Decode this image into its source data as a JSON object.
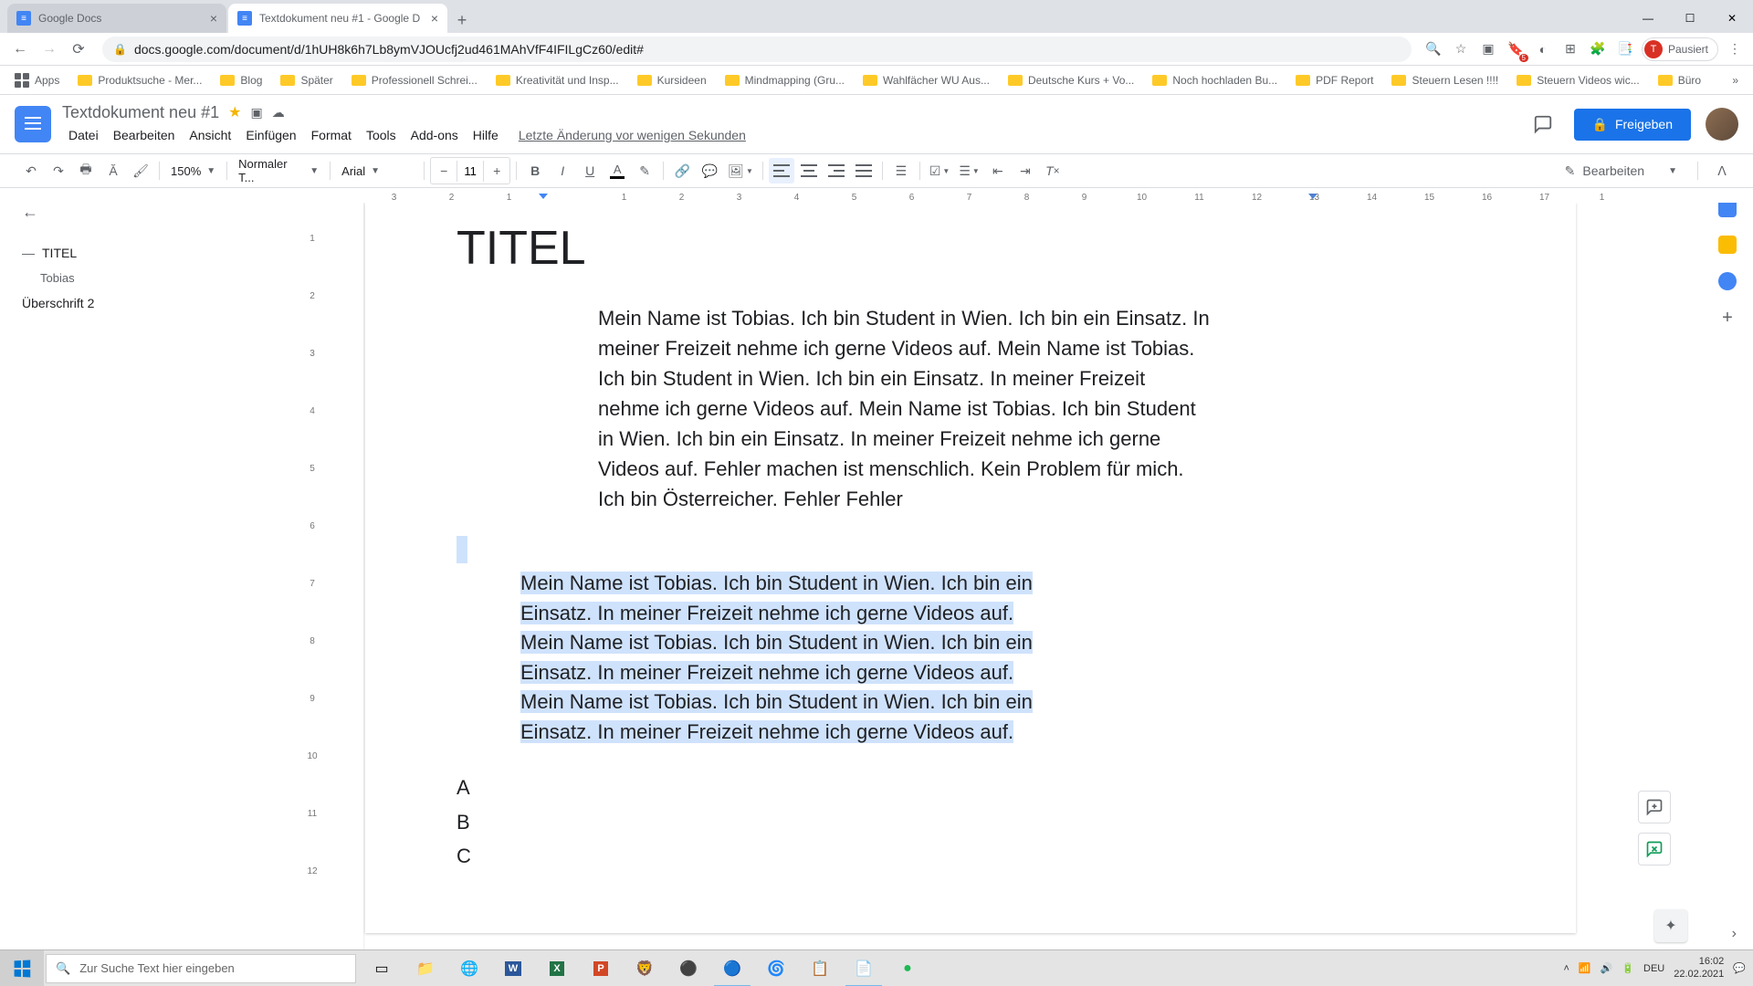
{
  "browser": {
    "tabs": [
      {
        "title": "Google Docs"
      },
      {
        "title": "Textdokument neu #1 - Google D"
      }
    ],
    "url": "docs.google.com/document/d/1hUH8k6h7Lb8ymVJOUcfj2ud461MAhVfF4IFILgCz60/edit#",
    "profile_status": "Pausiert",
    "profile_initial": "T"
  },
  "bookmarks": {
    "apps": "Apps",
    "items": [
      "Produktsuche - Mer...",
      "Blog",
      "Später",
      "Professionell Schrei...",
      "Kreativität und Insp...",
      "Kursideen",
      "Mindmapping (Gru...",
      "Wahlfächer WU Aus...",
      "Deutsche Kurs + Vo...",
      "Noch hochladen Bu...",
      "PDF Report",
      "Steuern Lesen !!!!",
      "Steuern Videos wic...",
      "Büro"
    ]
  },
  "docs": {
    "title": "Textdokument neu #1",
    "menus": [
      "Datei",
      "Bearbeiten",
      "Ansicht",
      "Einfügen",
      "Format",
      "Tools",
      "Add-ons",
      "Hilfe"
    ],
    "last_edit": "Letzte Änderung vor wenigen Sekunden",
    "share": "Freigeben",
    "mode": "Bearbeiten"
  },
  "toolbar": {
    "zoom": "150%",
    "style": "Normaler T...",
    "font": "Arial",
    "font_size": "11"
  },
  "outline": {
    "items": [
      {
        "label": "TITEL",
        "level": 0
      },
      {
        "label": "Tobias",
        "level": 1
      },
      {
        "label": "Überschrift 2",
        "level": 0
      }
    ]
  },
  "document": {
    "heading": "TITEL",
    "para1": "Mein Name ist Tobias. Ich bin Student in Wien. Ich bin ein Einsatz. In meiner Freizeit nehme ich gerne Videos auf. Mein Name ist Tobias. Ich bin Student in Wien. Ich bin ein Einsatz. In meiner Freizeit nehme ich gerne Videos auf. Mein Name ist Tobias. Ich bin Student in Wien. Ich bin ein Einsatz. In meiner Freizeit nehme ich gerne Videos auf. Fehler machen ist menschlich. Kein Problem für mich. Ich bin Österreicher. Fehler Fehler",
    "para2": "Mein Name ist Tobias. Ich bin Student in Wien. Ich bin ein Einsatz. In meiner Freizeit nehme ich gerne Videos auf. Mein Name ist Tobias. Ich bin Student in Wien. Ich bin ein Einsatz. In meiner Freizeit nehme ich gerne Videos auf. Mein Name ist Tobias. Ich bin Student in Wien. Ich bin ein Einsatz. In meiner Freizeit nehme ich gerne Videos auf.",
    "list": [
      "A",
      "B",
      "C"
    ]
  },
  "ruler": {
    "h": [
      "3",
      "2",
      "1",
      "",
      "1",
      "2",
      "3",
      "4",
      "5",
      "6",
      "7",
      "8",
      "9",
      "10",
      "11",
      "12",
      "13",
      "14",
      "15",
      "16",
      "17",
      "1"
    ],
    "v": [
      "",
      "1",
      "2",
      "3",
      "4",
      "5",
      "6",
      "7",
      "8",
      "9",
      "10",
      "11",
      "12"
    ]
  },
  "taskbar": {
    "search_placeholder": "Zur Suche Text hier eingeben",
    "lang": "DEU",
    "time": "16:02",
    "date": "22.02.2021"
  }
}
